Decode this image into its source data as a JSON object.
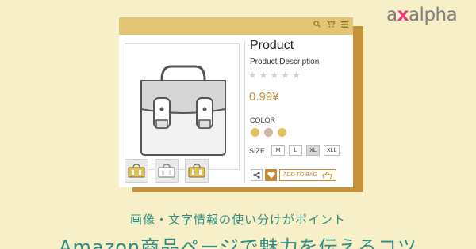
{
  "brand": {
    "logo_a": "a",
    "logo_x": "x",
    "logo_rest": "alpha",
    "accent": "#e6397f"
  },
  "card": {
    "header_icons": [
      "search-icon",
      "cart-icon",
      "menu-icon"
    ],
    "product_title": "Product",
    "product_description": "Product Description",
    "rating": {
      "stars_total": 5,
      "stars_filled": 0
    },
    "price": "0.99¥",
    "color_label": "COLOR",
    "colors": [
      "#e0c25f",
      "#d3b6a4",
      "#e0c25f"
    ],
    "size_label": "SIZE",
    "sizes": [
      "M",
      "L",
      "XL",
      "XLL"
    ],
    "selected_size": "XL",
    "add_to_bag": "ADD TO BAG",
    "thumbnail_colors": [
      "#e0c25f",
      "#ffffff",
      "#e0c25f"
    ]
  },
  "caption": {
    "subtitle": "画像・文字情報の使い分けがポイント",
    "title": "Amazon商品ページで魅力を伝えるコツ"
  },
  "colors": {
    "background": "#f6efc7",
    "header": "#e2c675",
    "shadow": "#c8923a",
    "accent_gold": "#c48a34",
    "text_teal": "#2f8c83"
  }
}
